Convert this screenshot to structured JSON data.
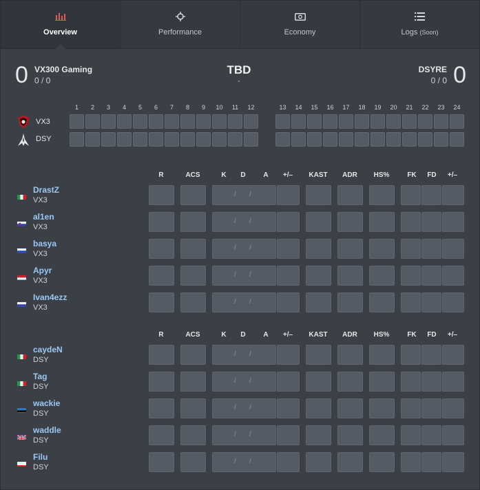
{
  "tabs": [
    {
      "label": "Overview",
      "icon": "bar-chart-icon",
      "active": true
    },
    {
      "label": "Performance",
      "icon": "crosshair-icon",
      "active": false
    },
    {
      "label": "Economy",
      "icon": "money-icon",
      "active": false
    },
    {
      "label": "Logs",
      "suffix": "(Soon)",
      "icon": "list-icon",
      "active": false
    }
  ],
  "match": {
    "left": {
      "score": "0",
      "name": "VX300 Gaming",
      "record": "0 / 0"
    },
    "right": {
      "score": "0",
      "name": "DSYRE",
      "record": "0 / 0"
    },
    "center_title": "TBD",
    "center_sub": "-"
  },
  "rounds": {
    "numbers": [
      "1",
      "2",
      "3",
      "4",
      "5",
      "6",
      "7",
      "8",
      "9",
      "10",
      "11",
      "12",
      "13",
      "14",
      "15",
      "16",
      "17",
      "18",
      "19",
      "20",
      "21",
      "22",
      "23",
      "24"
    ],
    "teams": [
      "VX3",
      "DSY"
    ]
  },
  "stat_headers": [
    "R",
    "ACS",
    "K",
    "D",
    "A",
    "+/–",
    "KAST",
    "ADR",
    "HS%",
    "FK",
    "FD",
    "+/–"
  ],
  "kda_separator": "/",
  "players_team1": [
    {
      "name": "DrastZ",
      "team": "VX3",
      "flag": "italy"
    },
    {
      "name": "al1en",
      "team": "VX3",
      "flag": "slovenia"
    },
    {
      "name": "basya",
      "team": "VX3",
      "flag": "russia"
    },
    {
      "name": "Apyr",
      "team": "VX3",
      "flag": "netherlands"
    },
    {
      "name": "Ivan4ezz",
      "team": "VX3",
      "flag": "russia"
    }
  ],
  "players_team2": [
    {
      "name": "caydeN",
      "team": "DSY",
      "flag": "italy"
    },
    {
      "name": "Tag",
      "team": "DSY",
      "flag": "italy"
    },
    {
      "name": "wackie",
      "team": "DSY",
      "flag": "estonia"
    },
    {
      "name": "waddle",
      "team": "DSY",
      "flag": "united-kingdom"
    },
    {
      "name": "Filu",
      "team": "DSY",
      "flag": "poland"
    }
  ],
  "colors": {
    "background": "#3b4047",
    "tab_bg": "#363a40",
    "cell": "#555b64",
    "player_name": "#9cc7f5",
    "vx3_logo": "#c0141e"
  }
}
